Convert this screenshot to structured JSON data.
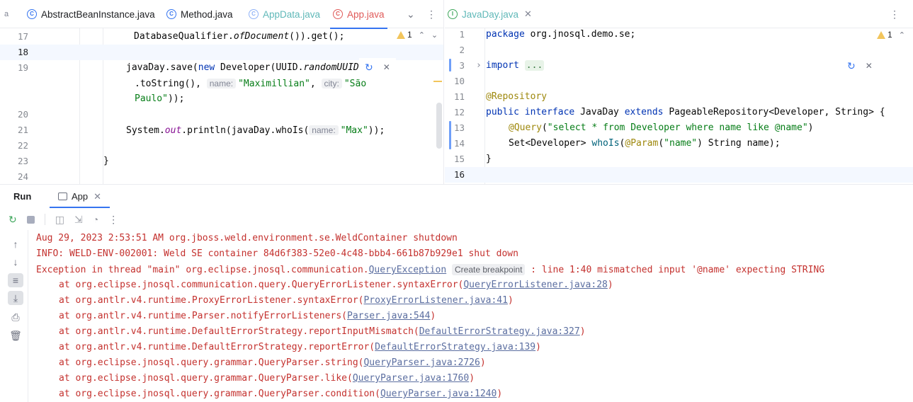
{
  "left_editor": {
    "tabs": [
      {
        "label": "AbstractBeanInstance.java",
        "state": "normal"
      },
      {
        "label": "Method.java",
        "state": "normal"
      },
      {
        "label": "AppData.java",
        "state": "muted"
      },
      {
        "label": "App.java",
        "state": "active"
      }
    ],
    "overflow_tab_fragment": "a",
    "class_icon_letter": "C",
    "warning_count": "1",
    "lines": [
      {
        "num": "17",
        "code_a": "DatabaseQualifier.",
        "code_b": "ofDocument",
        "code_c": "()).get();"
      },
      {
        "num": "18"
      },
      {
        "num": "19",
        "code_a": "javaDay.save(",
        "code_kw": "new",
        "code_b": " Developer(UUID.",
        "code_c": "randomUUID",
        "code_d": "()"
      },
      {
        "num": "",
        "code_a": ".toString(), ",
        "hint_a": "name:",
        "str_a": "\"Maximillian\"",
        "code_b": ", ",
        "hint_b": "city:",
        "str_b": "\"São"
      },
      {
        "num": "",
        "str_a": "Paulo\"",
        "code_a": "));"
      },
      {
        "num": "20"
      },
      {
        "num": "21",
        "code_a": "System.",
        "fld": "out",
        "code_b": ".println(javaDay.whoIs(",
        "hint_a": "name:",
        "str_a": "\"Max\"",
        "code_c": "));"
      },
      {
        "num": "22"
      },
      {
        "num": "23",
        "code_a": "}"
      },
      {
        "num": "24"
      }
    ]
  },
  "right_editor": {
    "tab": {
      "label": "JavaDay.java",
      "icon_letter": "I"
    },
    "warning_count": "1",
    "lines": [
      {
        "num": "1",
        "kw": "package",
        "code": " org.jnosql.demo.se;"
      },
      {
        "num": "2"
      },
      {
        "num": "3",
        "kw": "import",
        "fold": "..."
      },
      {
        "num": "10"
      },
      {
        "num": "11",
        "ann": "@Repository"
      },
      {
        "num": "12",
        "kw_a": "public",
        "kw_b": "interface",
        "code_a": " JavaDay ",
        "kw_c": "extends",
        "code_b": " PageableRepository<Developer, String> {"
      },
      {
        "num": "13",
        "ann": "@Query",
        "code_a": "(",
        "str": "\"select * from Developer where name like @name\"",
        "code_b": ")"
      },
      {
        "num": "14",
        "code_a": "Set<Developer> ",
        "mth": "whoIs",
        "code_b": "(",
        "ann": "@Param",
        "code_c": "(",
        "str": "\"name\"",
        "code_d": ") String name);"
      },
      {
        "num": "15",
        "code_a": "}"
      },
      {
        "num": "16"
      }
    ]
  },
  "run": {
    "title": "Run",
    "tab_label": "App",
    "console": {
      "line1": "Aug 29, 2023 2:53:51 AM org.jboss.weld.environment.se.WeldContainer shutdown",
      "line2": "INFO: WELD-ENV-002001: Weld SE container 84d6f383-52e0-4c48-bbb4-661b87b929e1 shut down",
      "exc_prefix": "Exception in thread \"main\" org.eclipse.jnosql.communication.",
      "exc_link": "QueryException",
      "exc_hint": "Create breakpoint",
      "exc_suffix": " : line 1:40 mismatched input '@name' expecting STRING",
      "stack": [
        {
          "at": "at org.eclipse.jnosql.communication.query.QueryErrorListener.syntaxError(",
          "link": "QueryErrorListener.java:28",
          "end": ")"
        },
        {
          "at": "at org.antlr.v4.runtime.ProxyErrorListener.syntaxError(",
          "link": "ProxyErrorListener.java:41",
          "end": ")"
        },
        {
          "at": "at org.antlr.v4.runtime.Parser.notifyErrorListeners(",
          "link": "Parser.java:544",
          "end": ")"
        },
        {
          "at": "at org.antlr.v4.runtime.DefaultErrorStrategy.reportInputMismatch(",
          "link": "DefaultErrorStrategy.java:327",
          "end": ")"
        },
        {
          "at": "at org.antlr.v4.runtime.DefaultErrorStrategy.reportError(",
          "link": "DefaultErrorStrategy.java:139",
          "end": ")"
        },
        {
          "at": "at org.eclipse.jnosql.query.grammar.QueryParser.string(",
          "link": "QueryParser.java:2726",
          "end": ")"
        },
        {
          "at": "at org.eclipse.jnosql.query.grammar.QueryParser.like(",
          "link": "QueryParser.java:1760",
          "end": ")"
        },
        {
          "at": "at org.eclipse.jnosql.query.grammar.QueryParser.condition(",
          "link": "QueryParser.java:1240",
          "end": ")"
        }
      ]
    }
  },
  "icons": [
    "rerun-icon",
    "stop-icon",
    "camera-icon",
    "login-icon",
    "gauge-icon",
    "more-icon",
    "arrow-up-icon",
    "arrow-down-icon",
    "soft-wrap-icon",
    "scroll-to-end-icon",
    "print-icon",
    "trash-icon"
  ],
  "colors": {
    "accent": "#3574f0",
    "error_text": "#c4312e",
    "keyword": "#0033b3",
    "string": "#067d17",
    "annotation": "#9e880d"
  }
}
